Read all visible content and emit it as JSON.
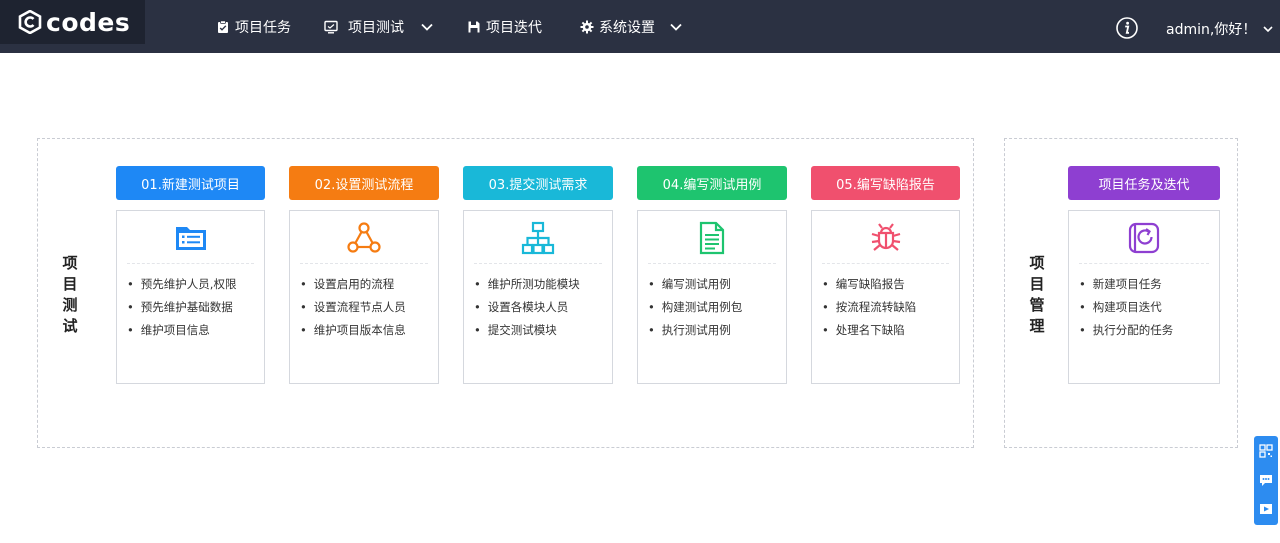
{
  "header": {
    "logo_text": "codes",
    "nav": [
      {
        "label": "项目任务",
        "icon": "clipboard-icon"
      },
      {
        "label": "项目测试",
        "icon": "monitor-icon",
        "dropdown": true
      },
      {
        "label": "项目迭代",
        "icon": "save-icon"
      },
      {
        "label": "系统设置",
        "icon": "gear-icon",
        "dropdown": true
      }
    ],
    "user_label": "admin,你好！"
  },
  "test_section": {
    "title_chars": [
      "项",
      "目",
      "测",
      "试"
    ],
    "steps": [
      {
        "title": "01.新建测试项目",
        "color": "#1e88f5",
        "icon": "folder-list-icon",
        "icon_color": "#1e88f5",
        "items": [
          "预先维护人员,权限",
          "预先维护基础数据",
          "维护项目信息"
        ]
      },
      {
        "title": "02.设置测试流程",
        "color": "#f57c12",
        "icon": "workflow-icon",
        "icon_color": "#f57c12",
        "items": [
          "设置启用的流程",
          "设置流程节点人员",
          "维护项目版本信息"
        ]
      },
      {
        "title": "03.提交测试需求",
        "color": "#19b8d8",
        "icon": "hierarchy-icon",
        "icon_color": "#19b8d8",
        "items": [
          "维护所测功能模块",
          "设置各模块人员",
          "提交测试模块"
        ]
      },
      {
        "title": "04.编写测试用例",
        "color": "#1ec46f",
        "icon": "document-icon",
        "icon_color": "#1ec46f",
        "items": [
          "编写测试用例",
          "构建测试用例包",
          "执行测试用例"
        ]
      },
      {
        "title": "05.编写缺陷报告",
        "color": "#f0506e",
        "icon": "bug-icon",
        "icon_color": "#f0506e",
        "items": [
          "编写缺陷报告",
          "按流程流转缺陷",
          "处理名下缺陷"
        ]
      }
    ]
  },
  "pm_section": {
    "title_chars": [
      "项",
      "目",
      "管",
      "理"
    ],
    "step": {
      "title": "项目任务及迭代",
      "color": "#8e3fd1",
      "icon": "task-cycle-icon",
      "icon_color": "#8e3fd1",
      "items": [
        "新建项目任务",
        "构建项目迭代",
        "执行分配的任务"
      ]
    }
  },
  "sidebar_tools": [
    {
      "icon": "qrcode-icon"
    },
    {
      "icon": "chat-icon"
    },
    {
      "icon": "video-icon"
    }
  ]
}
